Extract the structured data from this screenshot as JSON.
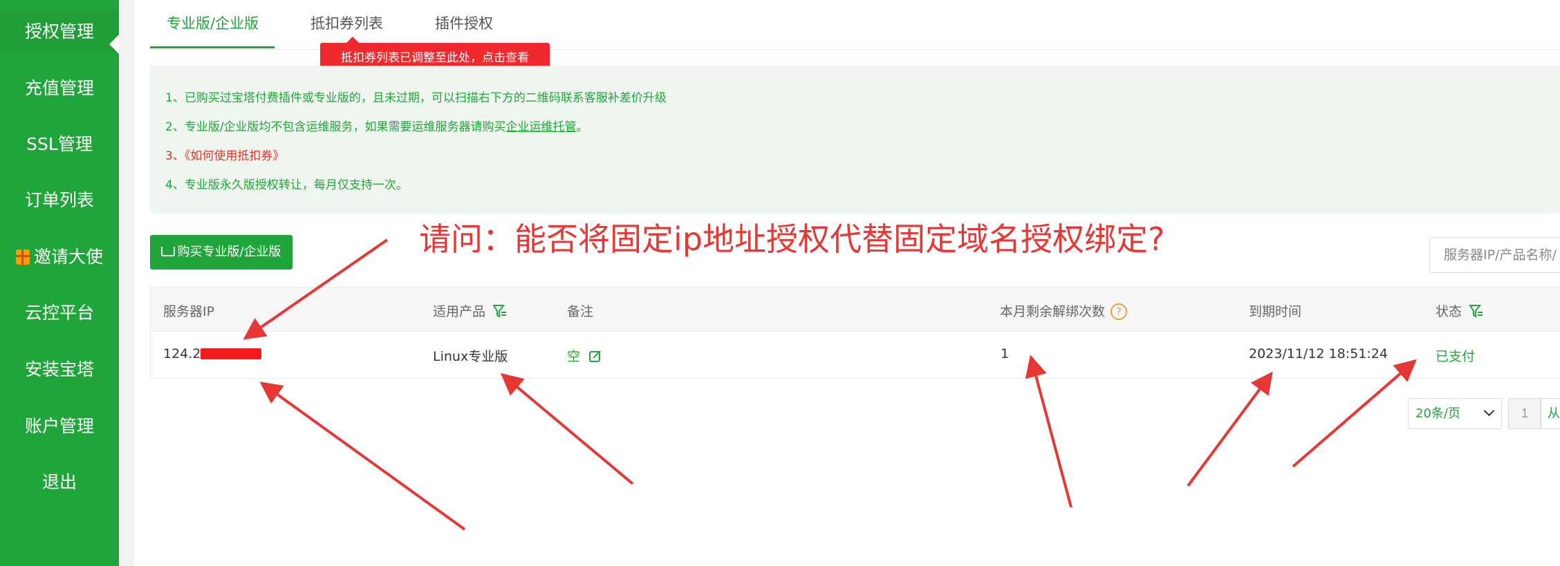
{
  "sidebar": {
    "items": [
      {
        "label": "授权管理"
      },
      {
        "label": "充值管理"
      },
      {
        "label": "SSL管理"
      },
      {
        "label": "订单列表"
      },
      {
        "label": "邀请大使"
      },
      {
        "label": "云控平台"
      },
      {
        "label": "安装宝塔"
      },
      {
        "label": "账户管理"
      },
      {
        "label": "退出"
      }
    ]
  },
  "tabs": [
    {
      "label": "专业版/企业版"
    },
    {
      "label": "抵扣券列表"
    },
    {
      "label": "插件授权"
    }
  ],
  "tooltip": "抵扣券列表已调整至此处，点击查看",
  "notice": {
    "line1": "1、已购买过宝塔付费插件或专业版的，且未过期，可以扫描右下方的二维码联系客服补差价升级",
    "line2_prefix": "2、专业版/企业版均不包含运维服务，如果需要运维服务器请购买",
    "line2_link": "企业运维托管",
    "line2_suffix": "。",
    "line3": "3、《如何使用抵扣券》",
    "line4": "4、专业版永久版授权转让，每月仅支持一次。"
  },
  "buy_button": "购买专业版/企业版",
  "annotation_question": "请问：能否将固定ip地址授权代替固定域名授权绑定?",
  "search": {
    "placeholder": "服务器IP/产品名称/"
  },
  "table": {
    "headers": [
      "服务器IP",
      "适用产品",
      "备注",
      "本月剩余解绑次数",
      "到期时间",
      "状态"
    ],
    "row": {
      "ip": "124.2",
      "product": "Linux专业版",
      "note": "空",
      "unbind_left": "1",
      "expire": "2023/11/12 18:51:24",
      "status": "已支付"
    }
  },
  "pagination": {
    "page_size": "20条/页",
    "current_page": "1",
    "from_label": "从"
  },
  "colors": {
    "brand": "#20a53a",
    "annotation": "#e53835",
    "tooltip": "#f0292f"
  }
}
